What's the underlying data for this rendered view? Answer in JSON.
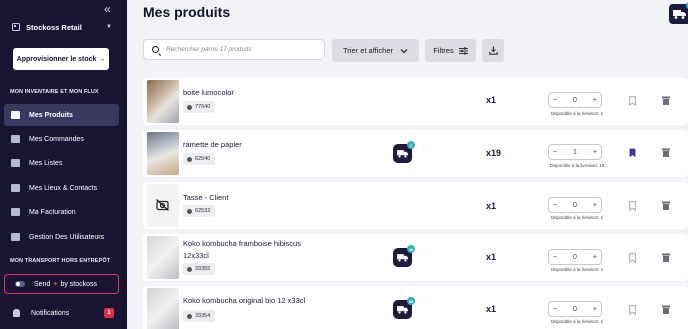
{
  "sidebar": {
    "collapse_icon": "«",
    "org_name": "Stockoss Retail",
    "restock_button": "Approvisionner le stock →",
    "section_inventory": "MON INVENTAIRE ET MON FLUX",
    "nav": [
      {
        "label": "Mes Produits",
        "icon": "box-icon",
        "active": true
      },
      {
        "label": "Mes Commandes",
        "icon": "cart-icon",
        "active": false
      },
      {
        "label": "Mes Listes",
        "icon": "list-icon",
        "active": false
      },
      {
        "label": "Mes Lieux & Contacts",
        "icon": "building-icon",
        "active": false
      },
      {
        "label": "Ma Facturation",
        "icon": "invoice-icon",
        "active": false
      },
      {
        "label": "Gestion Des Utilisateurs",
        "icon": "user-gear-icon",
        "active": false
      }
    ],
    "section_transport": "MON TRANSPORT HORS ENTREPÔT",
    "send_pre": "Send",
    "send_plus": "+",
    "send_post": "by stockoss",
    "notifications_label": "Notifications",
    "notifications_count": "1"
  },
  "header": {
    "title": "Mes produits"
  },
  "toolbar": {
    "search_placeholder": "Rechercher parmi 17 produits",
    "sort_label": "Trier et afficher",
    "filters_label": "Filtres"
  },
  "products": [
    {
      "name": "boite lumocolor",
      "name2": "",
      "sku": "77640",
      "qty": "x1",
      "count": "0",
      "available": "Disponible à la livraison: 1",
      "truck": false,
      "truck_badge": "",
      "bookmarked": false
    },
    {
      "name": "ramette de papier",
      "name2": "",
      "sku": "62540",
      "qty": "x19",
      "count": "1",
      "available": "Disponible à la livraison: 19",
      "truck": true,
      "truck_badge": "1",
      "bookmarked": true
    },
    {
      "name": "Tasse - Client",
      "name2": "",
      "sku": "62532",
      "qty": "x1",
      "count": "0",
      "available": "Disponible à la livraison: 1",
      "truck": false,
      "truck_badge": "",
      "bookmarked": false
    },
    {
      "name": "Koko kombucha framboise hibiscus",
      "name2": "12x33cl",
      "sku": "33355",
      "qty": "x1",
      "count": "0",
      "available": "Disponible à la livraison: 1",
      "truck": true,
      "truck_badge": "46",
      "bookmarked": false
    },
    {
      "name": "Koko kombucha original bio 12 x33cl",
      "name2": "",
      "sku": "33354",
      "qty": "x1",
      "count": "0",
      "available": "Disponible à la livraison: 1",
      "truck": true,
      "truck_badge": "58",
      "bookmarked": false
    }
  ],
  "colors": {
    "sidebar_bg": "#171533",
    "accent": "#3a3860",
    "bookmark_active": "#3b32b3",
    "badge_teal": "#2ab6b9",
    "alert_red": "#e0323f"
  }
}
